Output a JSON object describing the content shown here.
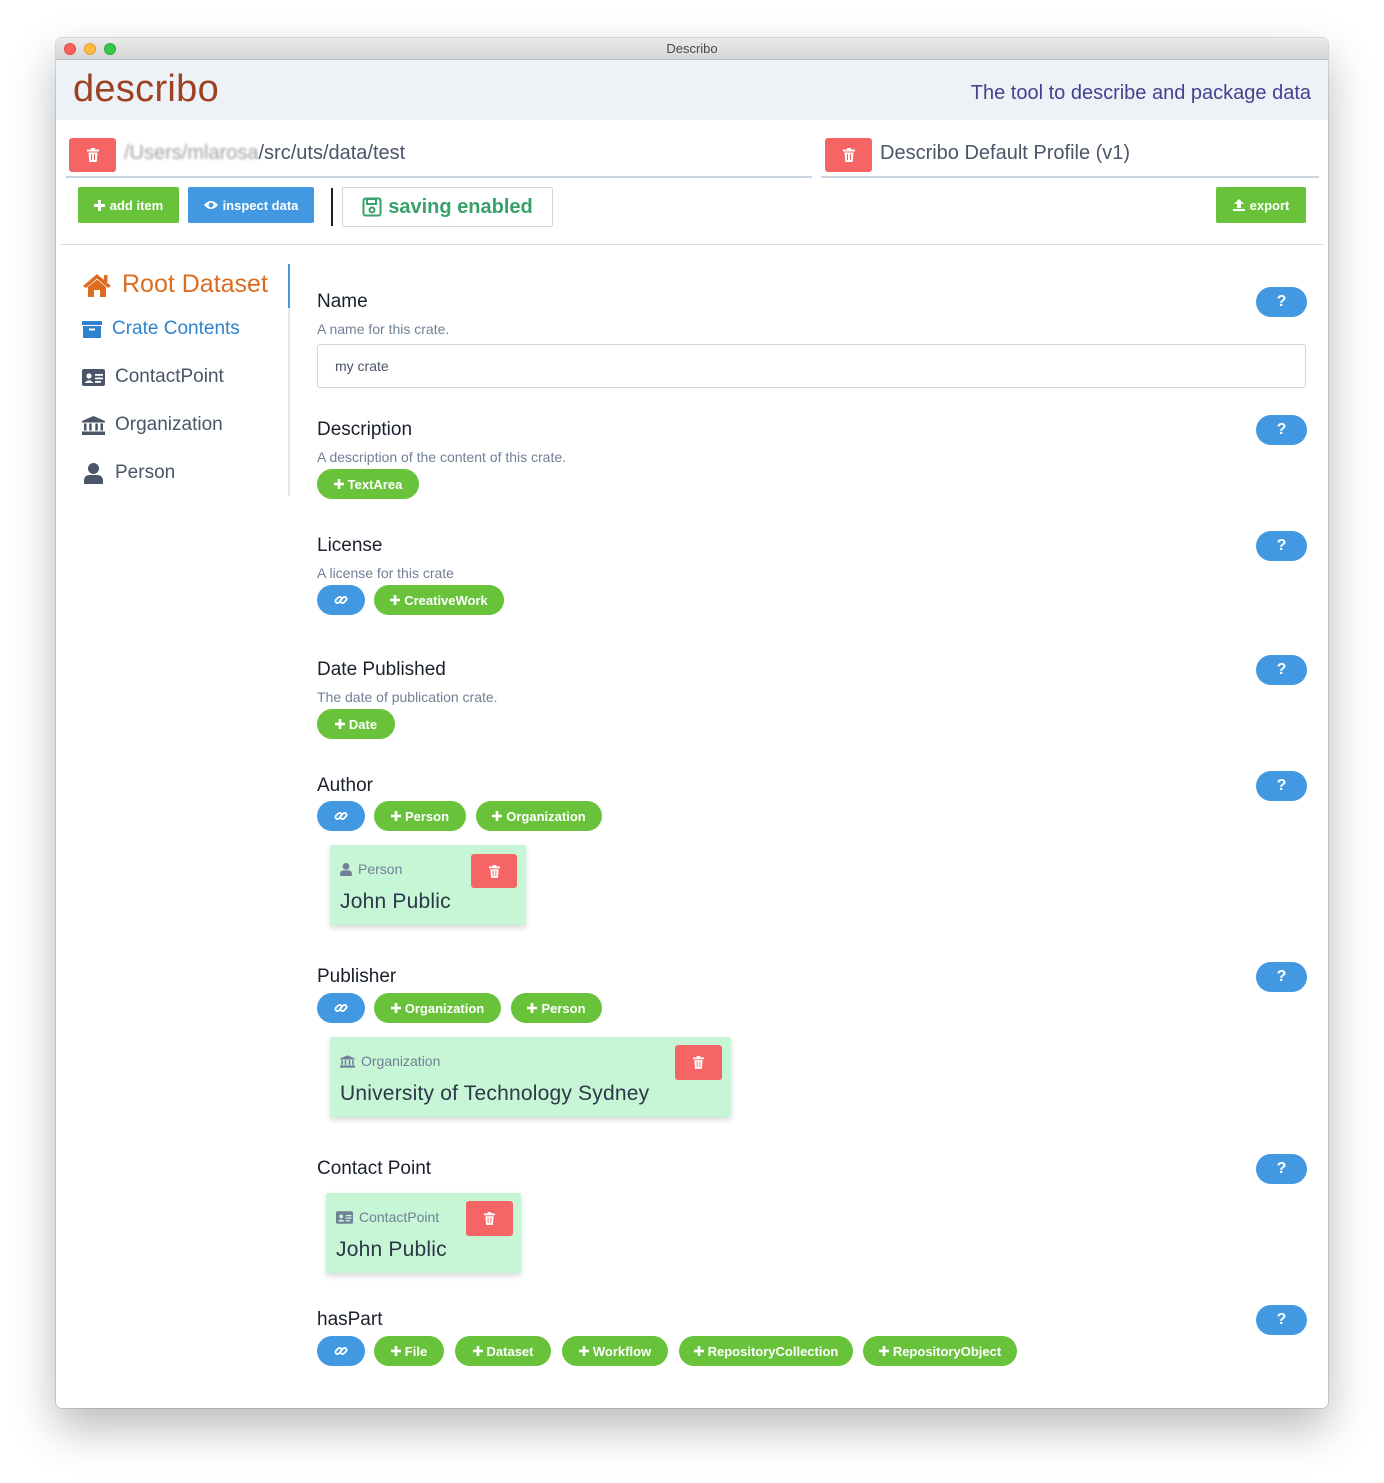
{
  "window": {
    "title": "Describo"
  },
  "header": {
    "brand": "describo",
    "tagline": "The tool to describe and package data"
  },
  "path": {
    "blurred_prefix": "/Users/mlarosa",
    "visible": "/src/uts/data/test"
  },
  "profile": {
    "name": "Describo Default Profile (v1)"
  },
  "toolbar": {
    "add_item": "add item",
    "inspect_data": "inspect data",
    "saving_status": "saving enabled",
    "export": "export"
  },
  "sidebar": {
    "root": "Root Dataset",
    "crate_contents": "Crate Contents",
    "items": [
      {
        "label": "ContactPoint",
        "icon": "address-card-icon"
      },
      {
        "label": "Organization",
        "icon": "university-icon"
      },
      {
        "label": "Person",
        "icon": "user-icon"
      }
    ]
  },
  "help_label": "?",
  "fields": {
    "name": {
      "label": "Name",
      "help": "A name for this crate.",
      "value": "my crate"
    },
    "description": {
      "label": "Description",
      "help": "A description of the content of this crate.",
      "add": [
        "TextArea"
      ]
    },
    "license": {
      "label": "License",
      "help": "A license for this crate",
      "add": [
        "CreativeWork"
      ]
    },
    "date_published": {
      "label": "Date Published",
      "help": "The date of publication crate.",
      "add": [
        "Date"
      ]
    },
    "author": {
      "label": "Author",
      "add": [
        "Person",
        "Organization"
      ],
      "entity": {
        "type": "Person",
        "name": "John Public"
      }
    },
    "publisher": {
      "label": "Publisher",
      "add": [
        "Organization",
        "Person"
      ],
      "entity": {
        "type": "Organization",
        "name": "University of Technology Sydney"
      }
    },
    "contact_point": {
      "label": "Contact Point",
      "entity": {
        "type": "ContactPoint",
        "name": "John Public"
      }
    },
    "has_part": {
      "label": "hasPart",
      "add": [
        "File",
        "Dataset",
        "Workflow",
        "RepositoryCollection",
        "RepositoryObject"
      ]
    }
  },
  "colors": {
    "brand": "#9c4221",
    "tagline": "#434190",
    "green": "#68c23a",
    "blue": "#4299e1",
    "red": "#f56565",
    "entity_card": "#c6f6d5",
    "root_active": "#dd6b20"
  }
}
